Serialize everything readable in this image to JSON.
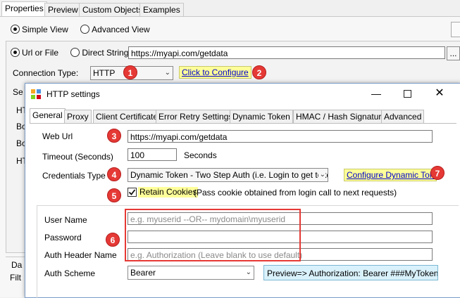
{
  "top_tabs": [
    "Properties",
    "Preview",
    "Custom Objects",
    "Examples"
  ],
  "view": {
    "simple": "Simple View",
    "advanced": "Advanced View"
  },
  "source": {
    "url_or_file": "Url or File",
    "direct_string": "Direct String",
    "url_value": "https://myapi.com/getdata",
    "browse": "..."
  },
  "connection": {
    "label": "Connection Type:",
    "value": "HTTP",
    "configure_link": "Click to Configure"
  },
  "background_labels": {
    "se": "Se",
    "ht1": "HT",
    "bo1": "Bo",
    "bo2": "Bo",
    "ht2": "HT",
    "da": "Da",
    "filt": "Filt"
  },
  "dialog": {
    "title": "HTTP settings",
    "tabs": [
      "General",
      "Proxy",
      "Client Certificate",
      "Error Retry Settings",
      "Dynamic Token",
      "HMAC / Hash Signature",
      "Advanced"
    ],
    "web_url_label": "Web Url",
    "web_url_value": "https://myapi.com/getdata",
    "timeout_label": "Timeout (Seconds)",
    "timeout_value": "100",
    "timeout_unit": "Seconds",
    "credentials_label": "Credentials Type",
    "credentials_value": "Dynamic Token - Two Step Auth (i.e. Login to get toker",
    "configure_token_link": "Configure Dynamic Token",
    "retain_cookies_label": "Retain Cookies",
    "retain_cookies_desc": "(Pass cookie obtained from login call to next requests)",
    "user_name_label": "User Name",
    "user_name_placeholder": "e.g. myuserid --OR-- mydomain\\myuserid",
    "password_label": "Password",
    "auth_header_label": "Auth Header Name",
    "auth_header_placeholder": "e.g. Authorization    (Leave blank to use default)",
    "auth_scheme_label": "Auth Scheme",
    "auth_scheme_value": "Bearer",
    "preview_text": "Preview=> Authorization: Bearer ###MyToken###"
  },
  "badges": [
    "1",
    "2",
    "3",
    "4",
    "5",
    "6",
    "7"
  ],
  "colors": {
    "badge": "#e53935",
    "highlight": "#ffff99",
    "link": "#0000cc",
    "annotation_box": "#e53935",
    "preview_bg": "#d9f1fb"
  }
}
